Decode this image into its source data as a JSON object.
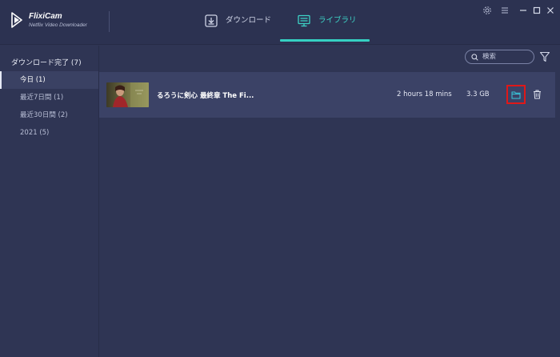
{
  "app": {
    "name": "FlixiCam",
    "subtitle": "Netflix Video Downloader"
  },
  "tabs": [
    {
      "label": "ダウンロード",
      "icon": "download-icon",
      "active": false
    },
    {
      "label": "ライブラリ",
      "icon": "monitor-icon",
      "active": true
    }
  ],
  "window_controls": [
    "gear-icon",
    "menu-icon",
    "minimize-icon",
    "maximize-icon",
    "close-icon"
  ],
  "sidebar": {
    "heading": "ダウンロード完了 (7)",
    "items": [
      {
        "label": "今日 (1)",
        "active": true
      },
      {
        "label": "最近7日間 (1)",
        "active": false
      },
      {
        "label": "最近30日間 (2)",
        "active": false
      },
      {
        "label": "2021 (5)",
        "active": false
      }
    ]
  },
  "search": {
    "placeholder": "検索"
  },
  "library": {
    "rows": [
      {
        "title": "るろうに剣心 最終章 The Fi...",
        "duration": "2 hours 18 mins",
        "size": "3.3 GB"
      }
    ]
  },
  "colors": {
    "accent": "#35d0c2",
    "background": "#2f3554",
    "row_background": "#3b4266",
    "highlight_border": "#e01818"
  }
}
